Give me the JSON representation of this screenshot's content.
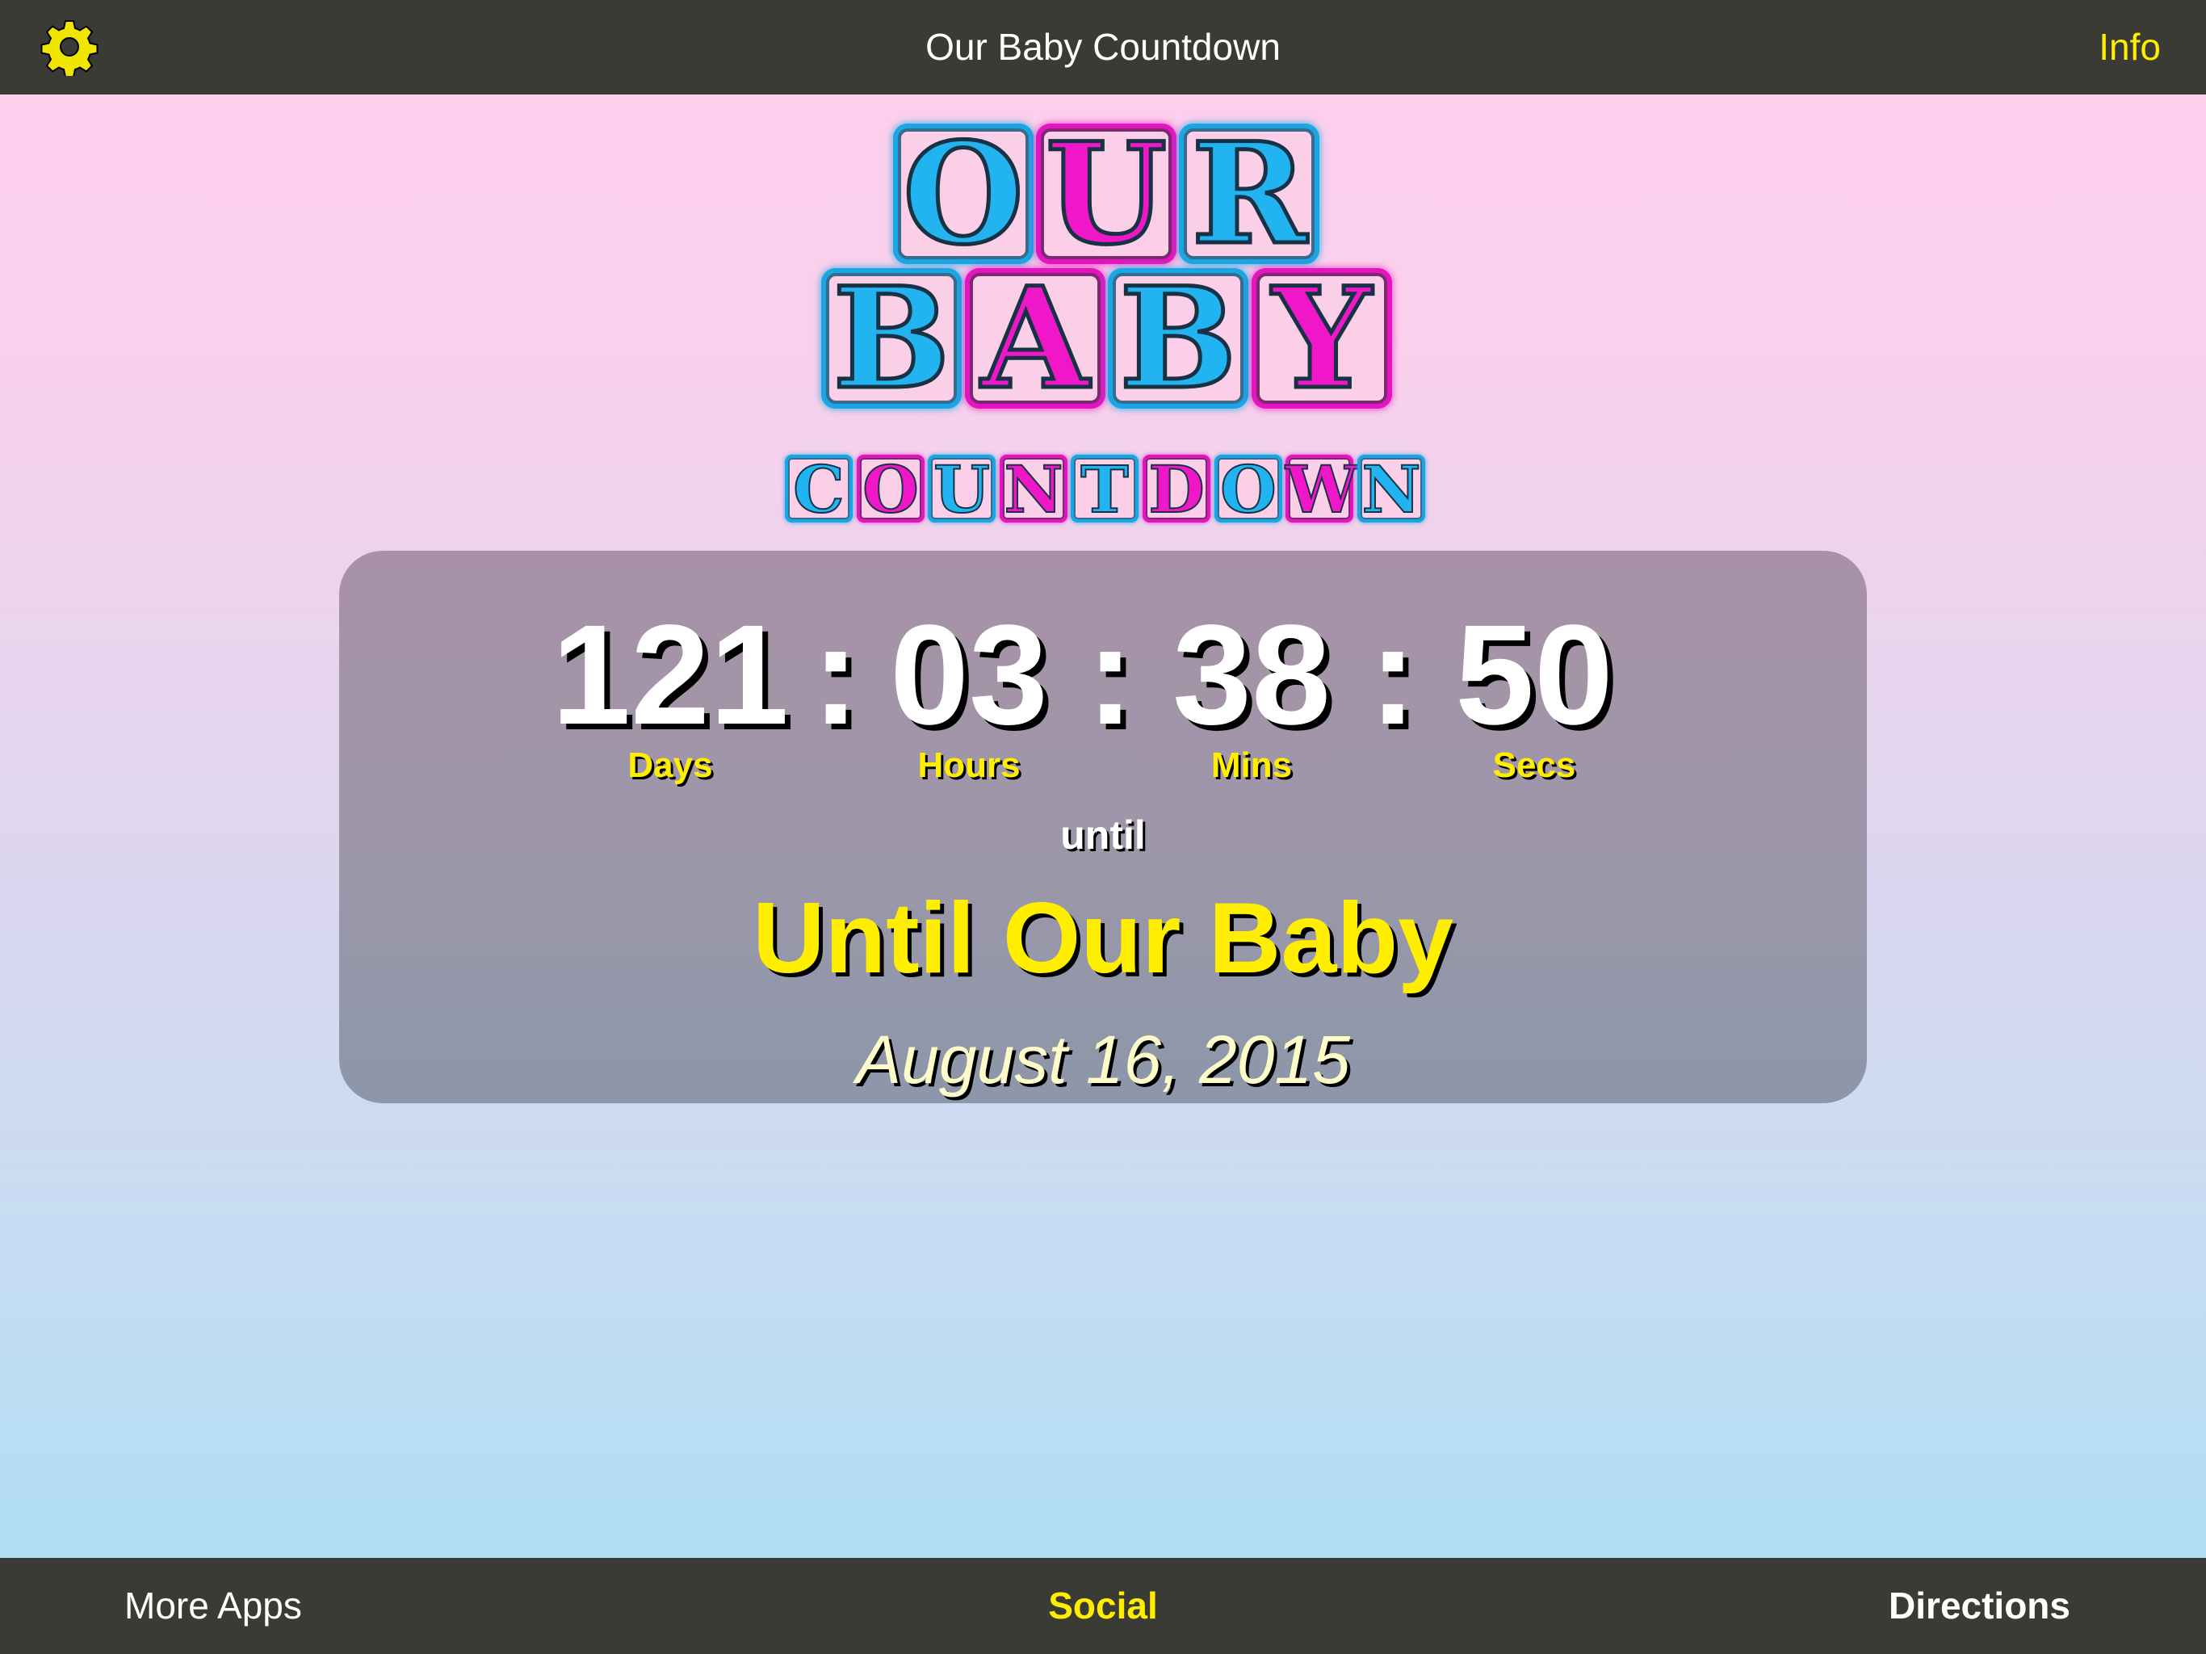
{
  "app": {
    "title": "Our Baby Countdown"
  },
  "top_bar": {
    "settings_icon": "gear-icon",
    "title": "Our Baby Countdown",
    "info_label": "Info"
  },
  "logo": {
    "row1": [
      "O",
      "U",
      "R"
    ],
    "row2": [
      "B",
      "A",
      "B",
      "Y"
    ],
    "row3": [
      "C",
      "O",
      "U",
      "N",
      "T",
      "D",
      "O",
      "W",
      "N"
    ],
    "colors": {
      "cyan": "#21b4f0",
      "magenta": "#ef17c8",
      "block_fill": "#fccfe8"
    }
  },
  "countdown": {
    "days": "121",
    "hours": "03",
    "mins": "38",
    "secs": "50",
    "separator": ":",
    "labels": {
      "days": "Days",
      "hours": "Hours",
      "mins": "Mins",
      "secs": "Secs"
    },
    "until_word": "until",
    "event_name": "Until Our Baby",
    "event_date": "August 16, 2015"
  },
  "bottom_bar": {
    "more_apps": "More Apps",
    "social": "Social",
    "directions": "Directions"
  },
  "theme": {
    "bar_color": "#3b3b36",
    "accent_yellow": "#ffee00"
  }
}
